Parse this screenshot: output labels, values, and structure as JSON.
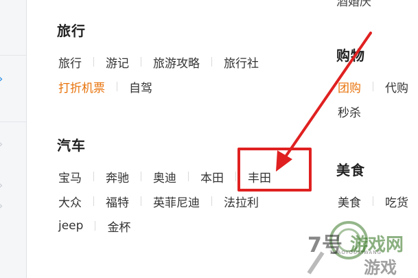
{
  "top_partial": "酒婚庆",
  "travel": {
    "heading": "旅行",
    "links": [
      "旅行",
      "游记",
      "旅游攻略",
      "旅行社"
    ],
    "links2": [
      "打折机票",
      "自驾"
    ]
  },
  "car": {
    "heading": "汽车",
    "links": [
      "宝马",
      "奔驰",
      "奥迪",
      "本田",
      "丰田"
    ],
    "links2": [
      "大众",
      "福特",
      "英菲尼迪",
      "法拉利"
    ],
    "links3": [
      "jeep",
      "金杯"
    ]
  },
  "shopping": {
    "heading": "购物",
    "links": [
      "团购",
      "代购"
    ],
    "links2": [
      "秒杀"
    ]
  },
  "food": {
    "heading": "美食",
    "links": [
      "美食",
      "吃货"
    ]
  },
  "watermark": {
    "number": "7号",
    "cn": "游戏网",
    "pinyin": "7HAOYOUXIWANG",
    "cn2": "游戏"
  },
  "colors": {
    "hot_link": "#e8730c",
    "highlight": "#e02020",
    "watermark_green": "#3c7a2a"
  }
}
